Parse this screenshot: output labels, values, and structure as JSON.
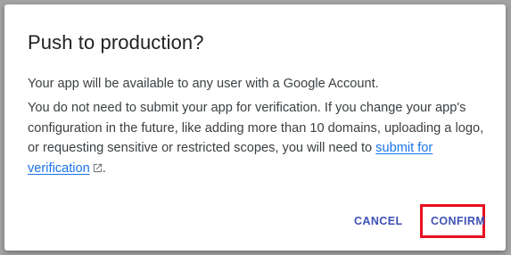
{
  "dialog": {
    "title": "Push to production?",
    "paragraph_1": "Your app will be available to any user with a Google Account.",
    "paragraph_2_text": "You do not need to submit your app for verification. If you change your app's configuration in the future, like adding more than 10 domains, uploading a logo, or requesting sensitive or restricted scopes, you will need to ",
    "paragraph_2_link": "submit for verification",
    "paragraph_2_end": ".",
    "link_icon": "external-link-icon",
    "cancel_label": "CANCEL",
    "confirm_label": "CONFIRM"
  },
  "colors": {
    "backdrop": "#a3a3a3",
    "surface": "#ffffff",
    "title_text": "#202124",
    "body_text": "#3c4043",
    "link": "#1a73e8",
    "button": "#3f51b5",
    "highlight_box": "#e8101f"
  }
}
